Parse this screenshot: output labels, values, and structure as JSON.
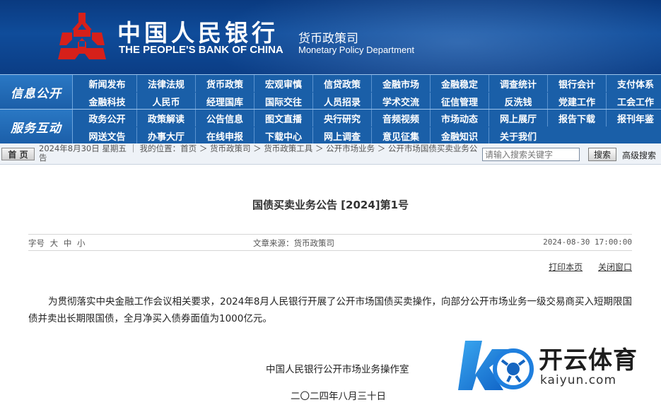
{
  "header": {
    "bank_cn": "中国人民银行",
    "bank_en": "THE PEOPLE'S BANK OF CHINA",
    "dept_cn": "货币政策司",
    "dept_en": "Monetary Policy Department"
  },
  "nav": {
    "section1_title": "信息公开",
    "section2_title": "服务互动",
    "row1": [
      "新闻发布",
      "法律法规",
      "货币政策",
      "宏观审慎",
      "信贷政策",
      "金融市场",
      "金融稳定",
      "调查统计",
      "银行会计",
      "支付体系"
    ],
    "row2": [
      "金融科技",
      "人民币",
      "经理国库",
      "国际交往",
      "人员招录",
      "学术交流",
      "征信管理",
      "反洗钱",
      "党建工作",
      "工会工作"
    ],
    "row3": [
      "政务公开",
      "政策解读",
      "公告信息",
      "图文直播",
      "央行研究",
      "音频视频",
      "市场动态",
      "网上展厅",
      "报告下载",
      "报刊年鉴"
    ],
    "row4": [
      "网送文告",
      "办事大厅",
      "在线申报",
      "下载中心",
      "网上调查",
      "意见征集",
      "金融知识",
      "关于我们"
    ]
  },
  "crumb": {
    "home_label": "首 页",
    "text": "2024年8月30日  星期五 ｜ 我的位置：首页   ＞  货币政策司  ＞  货币政策工具  ＞  公开市场业务  ＞  公开市场国债买卖业务公告",
    "search_placeholder": "请输入搜索关键字",
    "search_label": "搜索",
    "advanced_label": "高级搜索"
  },
  "article": {
    "title": "国债买卖业务公告 [2024]第1号",
    "font_label": "字号",
    "font_sizes": [
      "大",
      "中",
      "小"
    ],
    "source": "文章来源：货币政策司",
    "time": "2024-08-30 17:00:00",
    "print_label": "打印本页",
    "close_label": "关闭窗口",
    "paragraph": "为贯彻落实中央金融工作会议相关要求，2024年8月人民银行开展了公开市场国债买卖操作，向部分公开市场业务一级交易商买入短期限国债并卖出长期限国债，全月净买入债券面值为1000亿元。",
    "sign_org": "中国人民银行公开市场业务操作室",
    "sign_date": "二〇二四年八月三十日"
  },
  "watermark": {
    "cn": "开云体育",
    "en": "kaiyun.com"
  },
  "colors": {
    "header_blue": "#0f4c9a",
    "nav_blue": "#1a5fa8",
    "logo_red": "#d6201a"
  }
}
